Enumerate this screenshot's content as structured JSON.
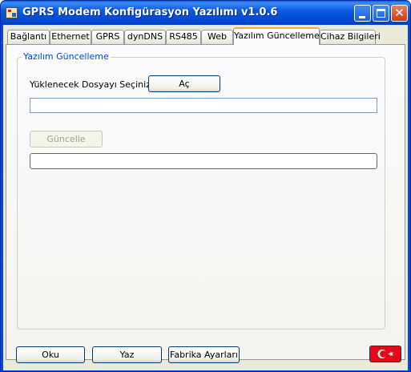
{
  "window": {
    "title": "GPRS Modem Konfigürasyon Yazılımı v1.0.6",
    "close_glyph": "✕"
  },
  "tabs": [
    {
      "label": "Bağlantı"
    },
    {
      "label": "Ethernet"
    },
    {
      "label": "GPRS"
    },
    {
      "label": "dynDNS"
    },
    {
      "label": "RS485"
    },
    {
      "label": "Web"
    },
    {
      "label": "Yazılım Güncelleme"
    },
    {
      "label": "Cihaz Bilgileri"
    }
  ],
  "active_tab": "Yazılım Güncelleme",
  "update": {
    "group_title": "Yazılım Güncelleme",
    "file_label": "Yüklenecek Dosyayı Seçiniz",
    "open_button": "Aç",
    "file_path": "",
    "update_button": "Güncelle",
    "update_enabled": false,
    "progress": 0
  },
  "footer": {
    "read_button": "Oku",
    "write_button": "Yaz",
    "factory_button": "Fabrika Ayarları",
    "language_flag": "turkish-flag-icon"
  },
  "colors": {
    "titlebar": "#0a5ae0",
    "group_title": "#0046d5",
    "active_tab_accent": "#f5ab35",
    "flag_red": "#e30a17"
  }
}
